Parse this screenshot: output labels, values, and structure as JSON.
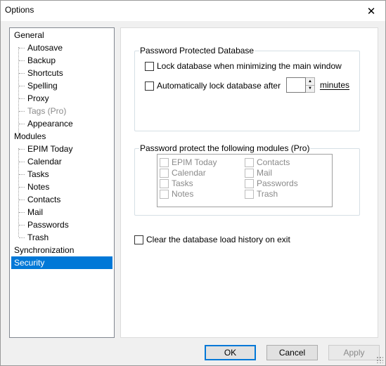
{
  "window": {
    "title": "Options"
  },
  "tree": {
    "items": [
      {
        "label": "General",
        "level": 0
      },
      {
        "label": "Autosave",
        "level": 1
      },
      {
        "label": "Backup",
        "level": 1
      },
      {
        "label": "Shortcuts",
        "level": 1
      },
      {
        "label": "Spelling",
        "level": 1
      },
      {
        "label": "Proxy",
        "level": 1
      },
      {
        "label": "Tags (Pro)",
        "level": 1,
        "disabled": true
      },
      {
        "label": "Appearance",
        "level": 1
      },
      {
        "label": "Modules",
        "level": 0
      },
      {
        "label": "EPIM Today",
        "level": 1
      },
      {
        "label": "Calendar",
        "level": 1
      },
      {
        "label": "Tasks",
        "level": 1
      },
      {
        "label": "Notes",
        "level": 1
      },
      {
        "label": "Contacts",
        "level": 1
      },
      {
        "label": "Mail",
        "level": 1
      },
      {
        "label": "Passwords",
        "level": 1
      },
      {
        "label": "Trash",
        "level": 1
      },
      {
        "label": "Synchronization",
        "level": 0
      },
      {
        "label": "Security",
        "level": 0,
        "selected": true
      }
    ]
  },
  "security": {
    "password_group": {
      "legend": "Password Protected Database",
      "lock_minimize_label": "Lock database when minimizing the main window",
      "auto_lock_label": "Automatically lock database after",
      "auto_lock_value": "",
      "minutes_label": "minutes"
    },
    "modules_group": {
      "legend": "Password protect the following modules (Pro)",
      "left": [
        "EPIM Today",
        "Calendar",
        "Tasks",
        "Notes"
      ],
      "right": [
        "Contacts",
        "Mail",
        "Passwords",
        "Trash"
      ]
    },
    "clear_history_label": "Clear the database load history on exit"
  },
  "buttons": {
    "ok": "OK",
    "cancel": "Cancel",
    "apply": "Apply"
  },
  "colors": {
    "selection": "#0078d7",
    "disabled_text": "#8a8a8a"
  }
}
